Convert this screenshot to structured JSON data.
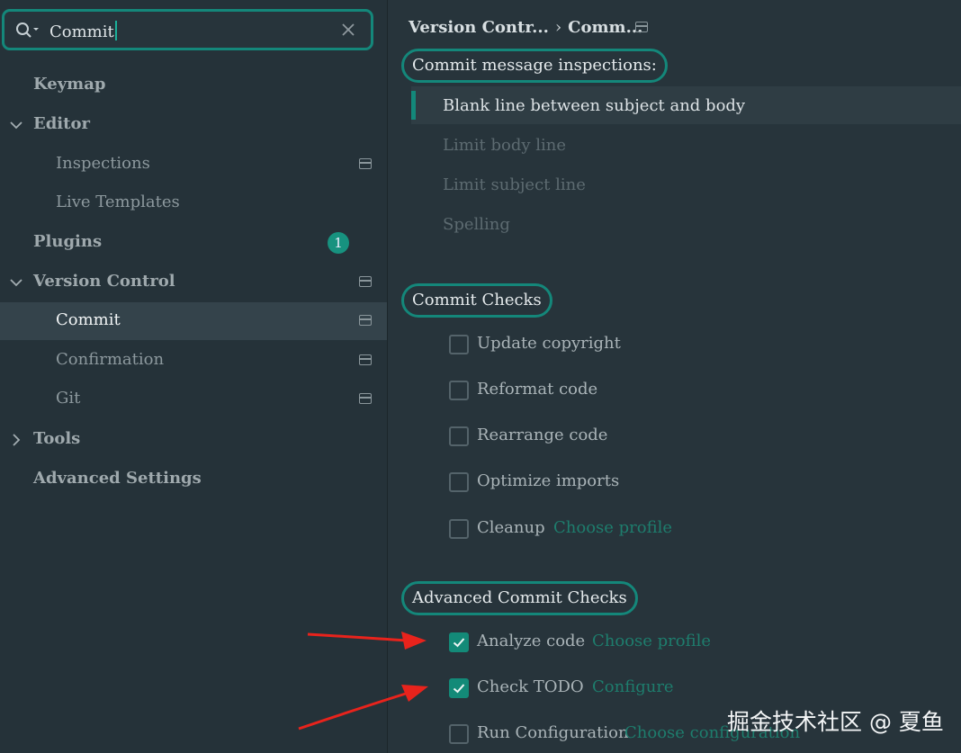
{
  "search": {
    "value": "Commit"
  },
  "sidebar": {
    "items": [
      {
        "label": "Keymap"
      },
      {
        "label": "Editor"
      },
      {
        "label": "Inspections"
      },
      {
        "label": "Live Templates"
      },
      {
        "label": "Plugins",
        "badge": "1"
      },
      {
        "label": "Version Control"
      },
      {
        "label": "Commit"
      },
      {
        "label": "Confirmation"
      },
      {
        "label": "Git"
      },
      {
        "label": "Tools"
      },
      {
        "label": "Advanced Settings"
      }
    ]
  },
  "breadcrumb": {
    "parent": "Version Contr...",
    "separator": "›",
    "current": "Comm..."
  },
  "inspections": {
    "title": "Commit message inspections:",
    "items": [
      {
        "label": "Blank line between subject and body"
      },
      {
        "label": "Limit body line"
      },
      {
        "label": "Limit subject line"
      },
      {
        "label": "Spelling"
      }
    ]
  },
  "commit_checks": {
    "title": "Commit Checks",
    "items": [
      {
        "label": "Update copyright",
        "checked": false
      },
      {
        "label": "Reformat code",
        "checked": false
      },
      {
        "label": "Rearrange code",
        "checked": false
      },
      {
        "label": "Optimize imports",
        "checked": false
      },
      {
        "label": "Cleanup",
        "checked": false,
        "link": "Choose profile"
      }
    ]
  },
  "advanced_checks": {
    "title": "Advanced Commit Checks",
    "items": [
      {
        "label": "Analyze code",
        "checked": true,
        "link": "Choose profile"
      },
      {
        "label": "Check TODO",
        "checked": true,
        "link": "Configure"
      },
      {
        "label": "Run Configuration",
        "checked": false,
        "link": "Choose configuration"
      }
    ]
  },
  "watermark": "掘金技术社区 @ 夏鱼",
  "colors": {
    "accent": "#14877a",
    "annotation_arrow": "#e8231c"
  }
}
